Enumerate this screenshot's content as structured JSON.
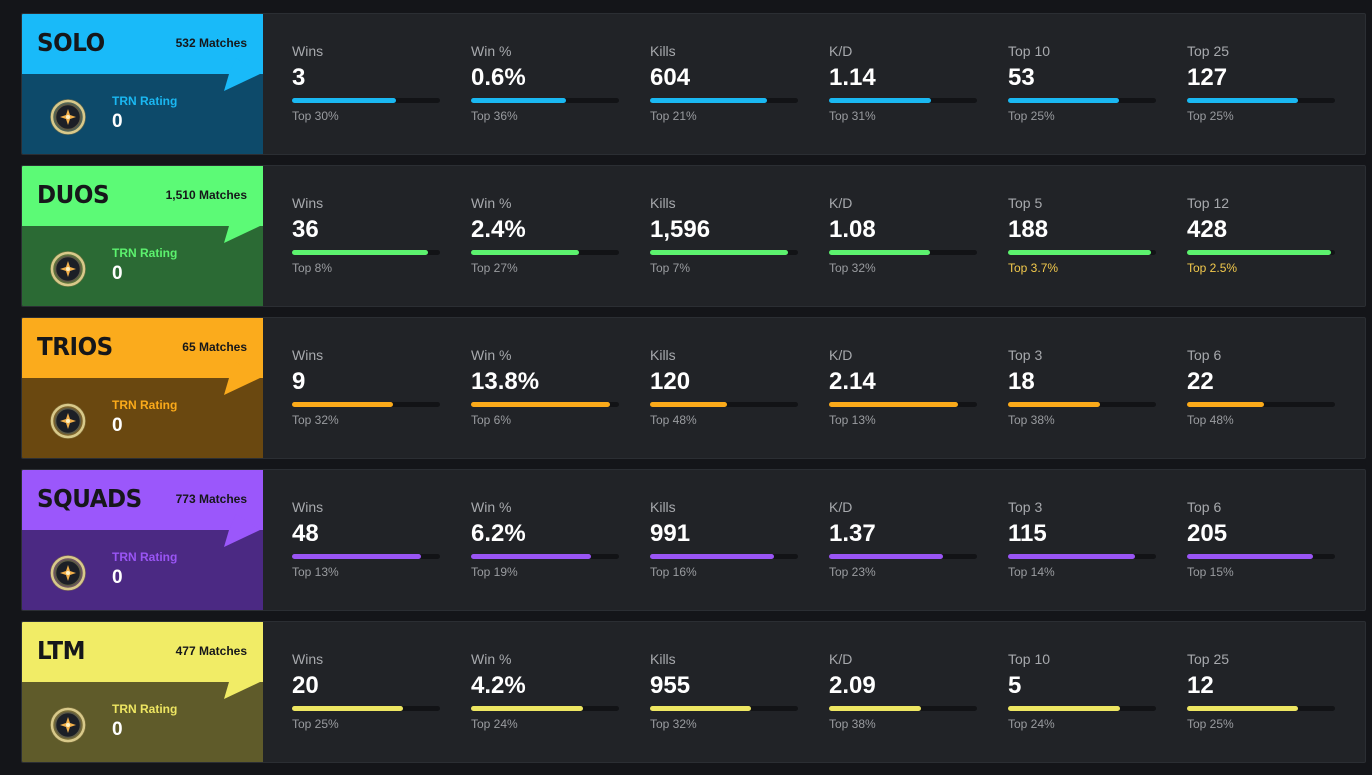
{
  "modes": [
    {
      "name": "SOLO",
      "matches": "532 Matches",
      "rating_label": "TRN Rating",
      "rating_value": "0",
      "colors": {
        "accent": "#1ab8f2",
        "header_bg": "#19baf9",
        "panel_bg": "#0d4a6a"
      },
      "stats": [
        {
          "label": "Wins",
          "value": "3",
          "rank": "Top 30%",
          "fill": 0.7
        },
        {
          "label": "Win %",
          "value": "0.6%",
          "rank": "Top 36%",
          "fill": 0.64
        },
        {
          "label": "Kills",
          "value": "604",
          "rank": "Top 21%",
          "fill": 0.79
        },
        {
          "label": "K/D",
          "value": "1.14",
          "rank": "Top 31%",
          "fill": 0.69
        },
        {
          "label": "Top 10",
          "value": "53",
          "rank": "Top 25%",
          "fill": 0.75
        },
        {
          "label": "Top 25",
          "value": "127",
          "rank": "Top 25%",
          "fill": 0.75
        }
      ]
    },
    {
      "name": "DUOS",
      "matches": "1,510 Matches",
      "rating_label": "TRN Rating",
      "rating_value": "0",
      "colors": {
        "accent": "#5cf26e",
        "header_bg": "#5cfa76",
        "panel_bg": "#2b6a34"
      },
      "stats": [
        {
          "label": "Wins",
          "value": "36",
          "rank": "Top 8%",
          "fill": 0.92
        },
        {
          "label": "Win %",
          "value": "2.4%",
          "rank": "Top 27%",
          "fill": 0.73
        },
        {
          "label": "Kills",
          "value": "1,596",
          "rank": "Top 7%",
          "fill": 0.93
        },
        {
          "label": "K/D",
          "value": "1.08",
          "rank": "Top 32%",
          "fill": 0.68
        },
        {
          "label": "Top 5",
          "value": "188",
          "rank": "Top 3.7%",
          "fill": 0.963,
          "rank_color": "#f2c94c"
        },
        {
          "label": "Top 12",
          "value": "428",
          "rank": "Top 2.5%",
          "fill": 0.975,
          "rank_color": "#f2c94c"
        }
      ]
    },
    {
      "name": "TRIOS",
      "matches": "65 Matches",
      "rating_label": "TRN Rating",
      "rating_value": "0",
      "colors": {
        "accent": "#fbaa1a",
        "header_bg": "#fbab1c",
        "panel_bg": "#6a4810"
      },
      "stats": [
        {
          "label": "Wins",
          "value": "9",
          "rank": "Top 32%",
          "fill": 0.68
        },
        {
          "label": "Win %",
          "value": "13.8%",
          "rank": "Top 6%",
          "fill": 0.94
        },
        {
          "label": "Kills",
          "value": "120",
          "rank": "Top 48%",
          "fill": 0.52
        },
        {
          "label": "K/D",
          "value": "2.14",
          "rank": "Top 13%",
          "fill": 0.87
        },
        {
          "label": "Top 3",
          "value": "18",
          "rank": "Top 38%",
          "fill": 0.62
        },
        {
          "label": "Top 6",
          "value": "22",
          "rank": "Top 48%",
          "fill": 0.52
        }
      ]
    },
    {
      "name": "SQUADS",
      "matches": "773 Matches",
      "rating_label": "TRN Rating",
      "rating_value": "0",
      "colors": {
        "accent": "#9a55f5",
        "header_bg": "#9b57fb",
        "panel_bg": "#4b2983"
      },
      "stats": [
        {
          "label": "Wins",
          "value": "48",
          "rank": "Top 13%",
          "fill": 0.87
        },
        {
          "label": "Win %",
          "value": "6.2%",
          "rank": "Top 19%",
          "fill": 0.81
        },
        {
          "label": "Kills",
          "value": "991",
          "rank": "Top 16%",
          "fill": 0.84
        },
        {
          "label": "K/D",
          "value": "1.37",
          "rank": "Top 23%",
          "fill": 0.77
        },
        {
          "label": "Top 3",
          "value": "115",
          "rank": "Top 14%",
          "fill": 0.86
        },
        {
          "label": "Top 6",
          "value": "205",
          "rank": "Top 15%",
          "fill": 0.85
        }
      ]
    },
    {
      "name": "LTM",
      "matches": "477 Matches",
      "rating_label": "TRN Rating",
      "rating_value": "0",
      "colors": {
        "accent": "#eee662",
        "header_bg": "#f1ec66",
        "panel_bg": "#5f5b2a"
      },
      "stats": [
        {
          "label": "Wins",
          "value": "20",
          "rank": "Top 25%",
          "fill": 0.75
        },
        {
          "label": "Win %",
          "value": "4.2%",
          "rank": "Top 24%",
          "fill": 0.76
        },
        {
          "label": "Kills",
          "value": "955",
          "rank": "Top 32%",
          "fill": 0.68
        },
        {
          "label": "K/D",
          "value": "2.09",
          "rank": "Top 38%",
          "fill": 0.62
        },
        {
          "label": "Top 10",
          "value": "5",
          "rank": "Top 24%",
          "fill": 0.76
        },
        {
          "label": "Top 25",
          "value": "12",
          "rank": "Top 25%",
          "fill": 0.75
        }
      ]
    }
  ]
}
